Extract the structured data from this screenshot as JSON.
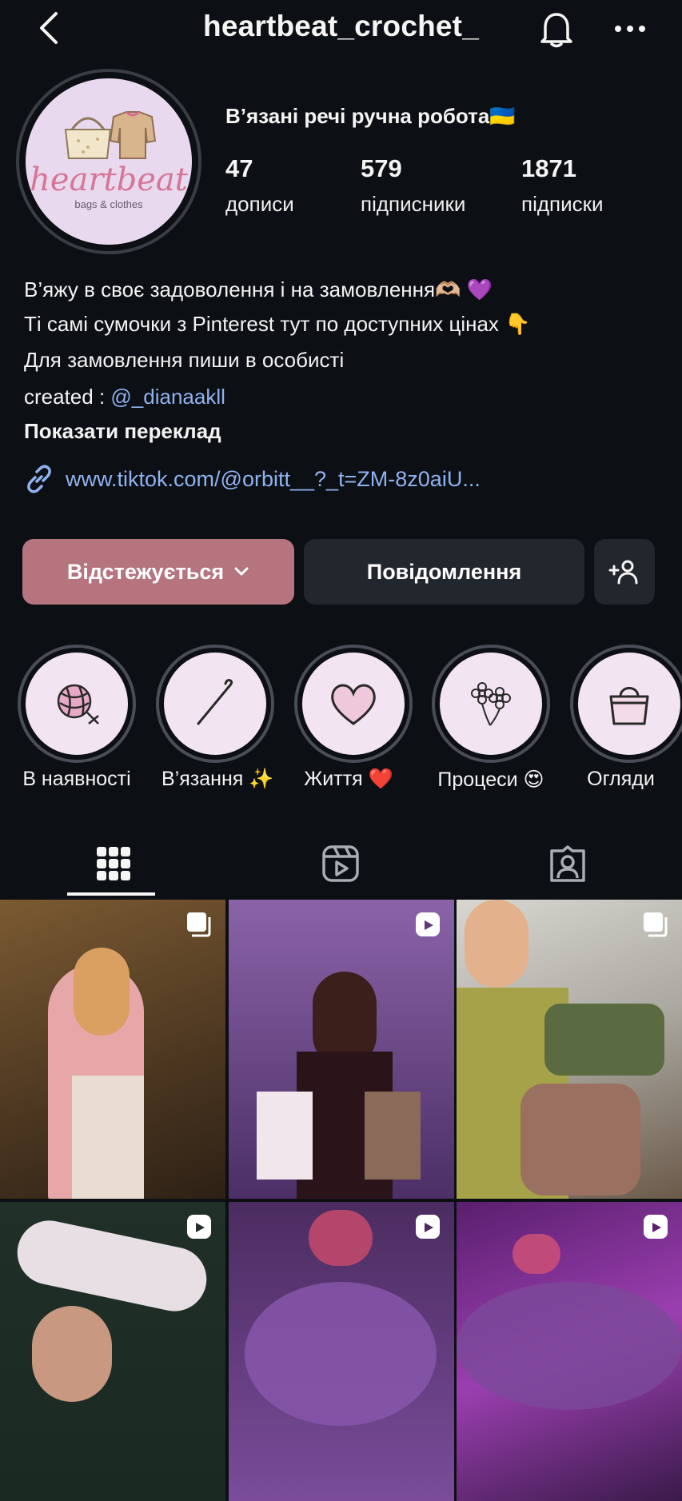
{
  "header": {
    "username": "heartbeat_crochet_"
  },
  "profile": {
    "name": "В’язані речі ручна робота🇺🇦",
    "avatar_word": "heartbeat",
    "avatar_sub": "bags & clothes",
    "stats": [
      {
        "value": "47",
        "label": "дописи"
      },
      {
        "value": "579",
        "label": "підписники"
      },
      {
        "value": "1871",
        "label": "підписки"
      }
    ]
  },
  "bio": {
    "line1": "В’яжу в своє задоволення і на замовлення🫶🏼 💜",
    "line2": "Ті самі сумочки з Pinterest тут по доступних цінах 👇",
    "line3": "Для замовлення пиши в особисті",
    "created_prefix": "created : ",
    "mention": "@_dianaakll",
    "translate": "Показати переклад",
    "link": "www.tiktok.com/@orbitt__?_t=ZM-8z0aiU..."
  },
  "actions": {
    "follow_label": "Відстежується",
    "message_label": "Повідомлення"
  },
  "highlights": [
    {
      "label": "В наявності",
      "icon": "yarn-ball-icon"
    },
    {
      "label": "В’язання ✨",
      "icon": "crochet-hook-icon"
    },
    {
      "label": "Життя ❤️",
      "icon": "heart-icon"
    },
    {
      "label": "Процеси 😍",
      "icon": "flowers-icon"
    },
    {
      "label": "Огляди",
      "icon": "handbag-icon"
    }
  ],
  "tabs": [
    "grid-icon",
    "reels-icon",
    "tagged-icon"
  ],
  "posts": [
    {
      "type": "carousel"
    },
    {
      "type": "reel"
    },
    {
      "type": "carousel"
    },
    {
      "type": "reel"
    },
    {
      "type": "reel"
    },
    {
      "type": "reel"
    }
  ],
  "colors": {
    "background": "#0c0f14",
    "follow_button": "#b6747f",
    "link": "#8fb3f0",
    "button_dark": "#22262d"
  }
}
